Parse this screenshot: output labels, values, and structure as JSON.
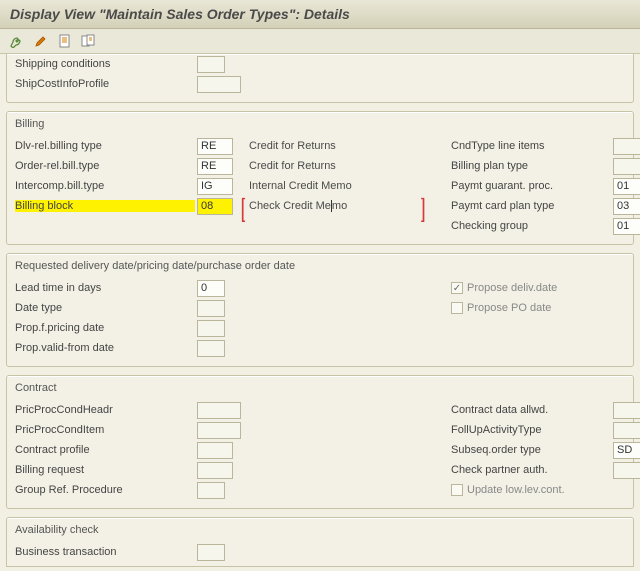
{
  "title": "Display View \"Maintain Sales Order Types\": Details",
  "toolbar": {
    "icons": [
      "tool-icon",
      "brush-icon",
      "page-icon",
      "copy-icon"
    ]
  },
  "topPartial": {
    "rows": [
      {
        "label": "Shipping conditions",
        "value": ""
      },
      {
        "label": "ShipCostInfoProfile",
        "value": ""
      }
    ]
  },
  "billing": {
    "title": "Billing",
    "left": [
      {
        "label": "Dlv-rel.billing type",
        "value": "RE",
        "desc": "Credit for Returns"
      },
      {
        "label": "Order-rel.bill.type",
        "value": "RE",
        "desc": "Credit for Returns"
      },
      {
        "label": "Intercomp.bill.type",
        "value": "IG",
        "desc": "Internal Credit Memo"
      },
      {
        "label": "Billing block",
        "value": "08",
        "desc": "Check Credit Memo",
        "hl": true
      }
    ],
    "right": [
      {
        "label": "CndType line items",
        "value": ""
      },
      {
        "label": "Billing plan type",
        "value": ""
      },
      {
        "label": "Paymt guarant. proc.",
        "value": "01"
      },
      {
        "label": "Paymt card plan type",
        "value": "03"
      },
      {
        "label": "Checking group",
        "value": "01"
      }
    ]
  },
  "requested": {
    "title": "Requested delivery date/pricing date/purchase order date",
    "left": [
      {
        "label": "Lead time in days",
        "value": "0"
      },
      {
        "label": "Date type",
        "value": ""
      },
      {
        "label": "Prop.f.pricing date",
        "value": ""
      },
      {
        "label": "Prop.valid-from date",
        "value": ""
      }
    ],
    "checks": [
      {
        "label": "Propose deliv.date",
        "checked": true
      },
      {
        "label": "Propose PO date",
        "checked": false
      }
    ]
  },
  "contract": {
    "title": "Contract",
    "left": [
      {
        "label": "PricProcCondHeadr",
        "value": ""
      },
      {
        "label": "PricProcCondItem",
        "value": ""
      },
      {
        "label": "Contract profile",
        "value": ""
      },
      {
        "label": "Billing request",
        "value": ""
      },
      {
        "label": "Group Ref. Procedure",
        "value": ""
      }
    ],
    "right": [
      {
        "label": "Contract data allwd.",
        "value": ""
      },
      {
        "label": "FollUpActivityType",
        "value": ""
      },
      {
        "label": "Subseq.order type",
        "value": "SD"
      },
      {
        "label": "Check partner auth.",
        "value": ""
      }
    ],
    "check": {
      "label": "Update low.lev.cont.",
      "checked": false
    }
  },
  "availability": {
    "title": "Availability check",
    "rows": [
      {
        "label": "Business transaction",
        "value": ""
      }
    ]
  }
}
